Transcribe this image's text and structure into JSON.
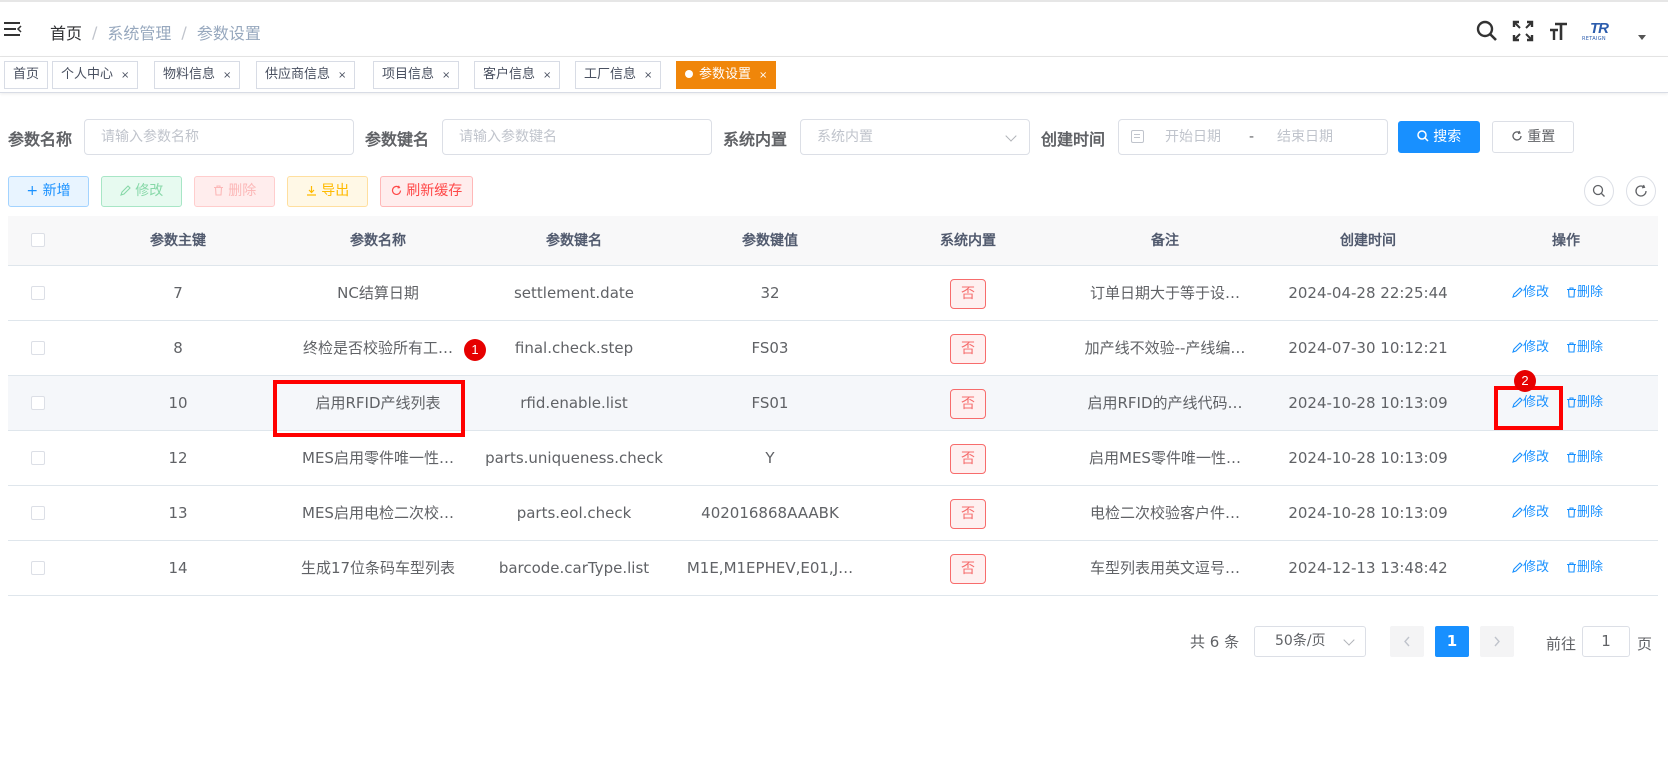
{
  "breadcrumb": {
    "home": "首页",
    "parent": "系统管理",
    "current": "参数设置"
  },
  "tags": [
    {
      "label": "首页"
    },
    {
      "label": "个人中心"
    },
    {
      "label": "物料信息"
    },
    {
      "label": "供应商信息"
    },
    {
      "label": "项目信息"
    },
    {
      "label": "客户信息"
    },
    {
      "label": "工厂信息"
    },
    {
      "label": "参数设置",
      "active": true
    }
  ],
  "tag_close": "×",
  "search": {
    "name_label": "参数名称",
    "name_placeholder": "请输入参数名称",
    "key_label": "参数键名",
    "key_placeholder": "请输入参数键名",
    "builtin_label": "系统内置",
    "builtin_placeholder": "系统内置",
    "time_label": "创建时间",
    "start_placeholder": "开始日期",
    "range_sep": "-",
    "end_placeholder": "结束日期",
    "search_button": "搜索",
    "reset_button": "重置"
  },
  "toolbar": {
    "add": "新增",
    "edit": "修改",
    "delete": "删除",
    "export": "导出",
    "refresh_cache": "刷新缓存"
  },
  "table": {
    "headers": [
      "参数主键",
      "参数名称",
      "参数键名",
      "参数键值",
      "系统内置",
      "备注",
      "创建时间",
      "操作"
    ],
    "rows": [
      {
        "id": "7",
        "name": "NC结算日期",
        "key": "settlement.date",
        "value": "32",
        "builtin": "否",
        "remark": "订单日期大于等于设…",
        "created": "2024-04-28 22:25:44"
      },
      {
        "id": "8",
        "name": "终检是否校验所有工…",
        "key": "final.check.step",
        "value": "FS03",
        "builtin": "否",
        "remark": "加产线不效验--产线编…",
        "created": "2024-07-30 10:12:21"
      },
      {
        "id": "10",
        "name": "启用RFID产线列表",
        "key": "rfid.enable.list",
        "value": "FS01",
        "builtin": "否",
        "remark": "启用RFID的产线代码…",
        "created": "2024-10-28 10:13:09"
      },
      {
        "id": "12",
        "name": "MES启用零件唯一性…",
        "key": "parts.uniqueness.check",
        "value": "Y",
        "builtin": "否",
        "remark": "启用MES零件唯一性…",
        "created": "2024-10-28 10:13:09"
      },
      {
        "id": "13",
        "name": "MES启用电检二次校…",
        "key": "parts.eol.check",
        "value": "402016868AAABK",
        "builtin": "否",
        "remark": "电检二次校验客户件…",
        "created": "2024-10-28 10:13:09"
      },
      {
        "id": "14",
        "name": "生成17位条码车型列表",
        "key": "barcode.carType.list",
        "value": "M1E,M1EPHEV,E01,J…",
        "builtin": "否",
        "remark": "车型列表用英文逗号…",
        "created": "2024-12-13 13:48:42"
      }
    ],
    "op_edit": "修改",
    "op_delete": "删除"
  },
  "annotations": {
    "marker1": "1",
    "marker2": "2"
  },
  "pagination": {
    "total": "共 6 条",
    "page_size": "50条/页",
    "current_page": "1",
    "jump_label": "前往",
    "jump_value": "1",
    "jump_suffix": "页"
  },
  "brand_logo": {
    "mark": "TR",
    "subtext": "RETAIGN"
  },
  "colors": {
    "primary": "#1890ff",
    "active_tag": "#f0860a",
    "annotation_red": "#ff0000"
  }
}
